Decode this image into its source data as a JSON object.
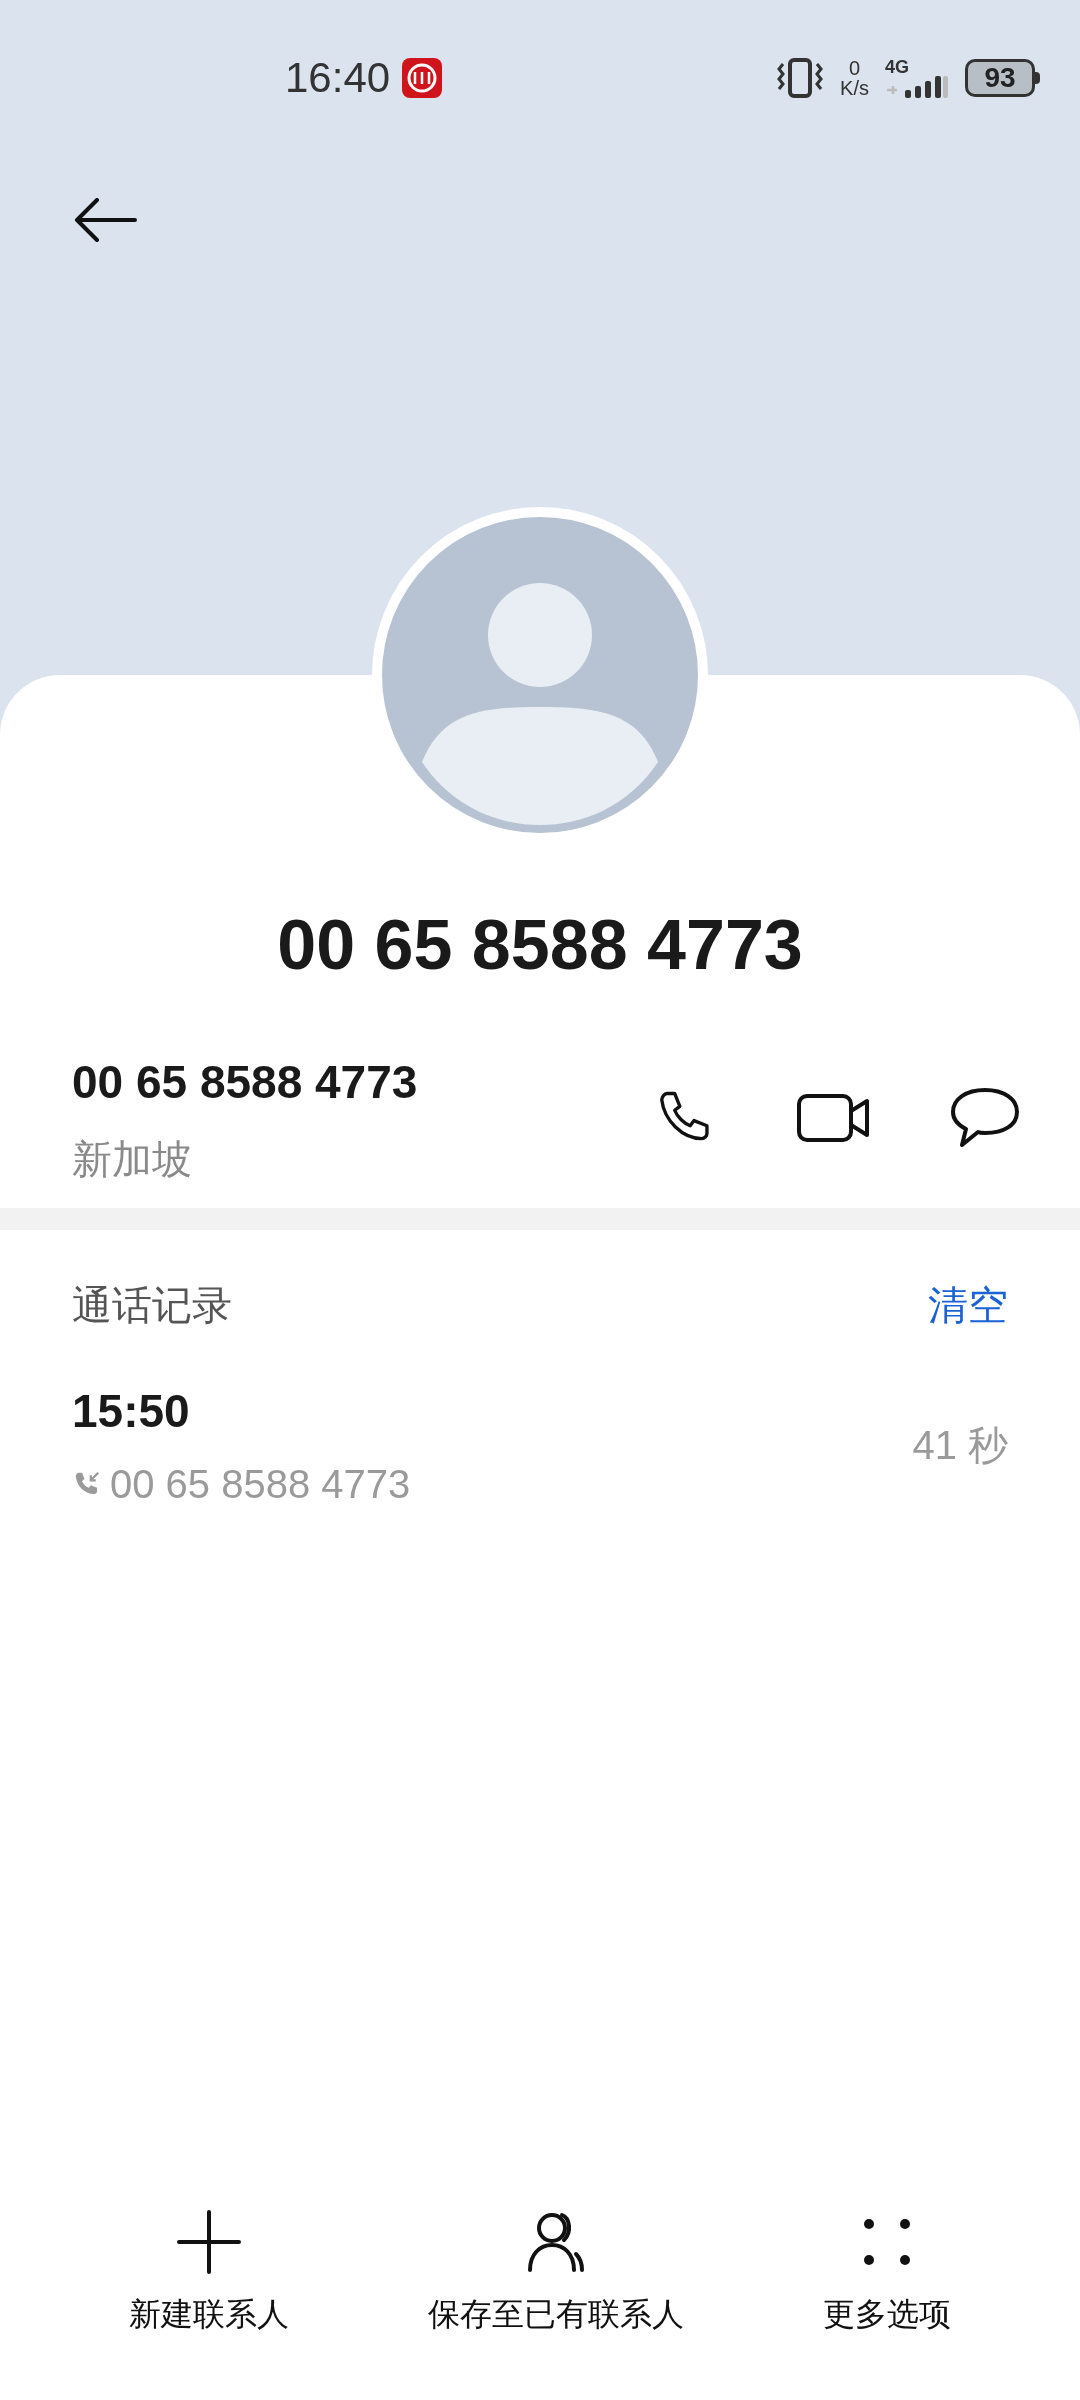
{
  "status_bar": {
    "time": "16:40",
    "net_speed_value": "0",
    "net_speed_unit": "K/s",
    "network": "4G",
    "battery": "93"
  },
  "contact": {
    "title": "00 65 8588 4773",
    "number": "00 65 8588 4773",
    "location": "新加坡"
  },
  "call_log": {
    "title": "通话记录",
    "clear": "清空",
    "entries": [
      {
        "time": "15:50",
        "number": "00 65 8588 4773",
        "duration": "41 秒",
        "kind": "incoming"
      }
    ]
  },
  "actions": [
    {
      "label": "新建联系人",
      "kind": "add"
    },
    {
      "label": "保存至已有联系人",
      "kind": "person"
    },
    {
      "label": "更多选项",
      "kind": "more"
    }
  ]
}
